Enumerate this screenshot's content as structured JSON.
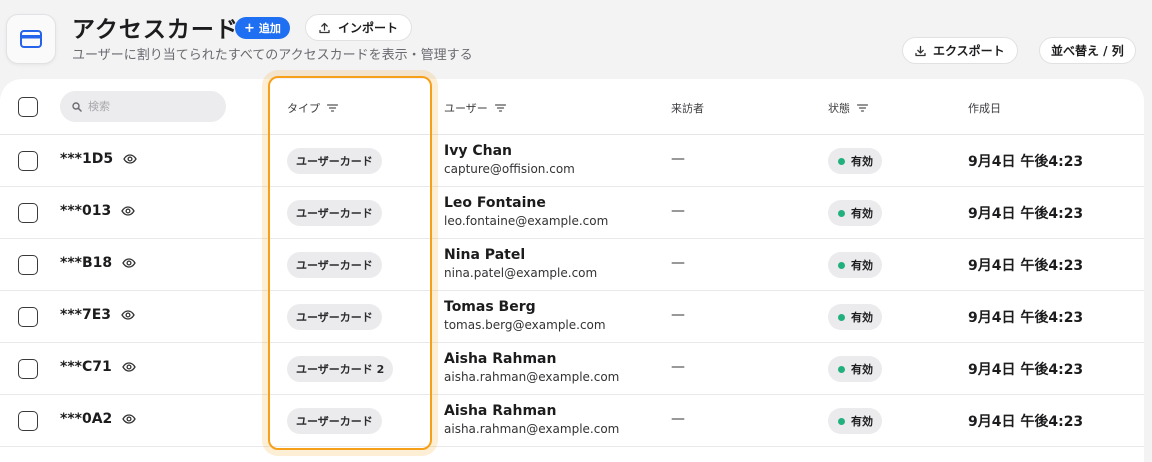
{
  "header": {
    "title": "アクセスカード",
    "add_label": "追加",
    "import_label": "インポート",
    "subtitle": "ユーザーに割り当てられたすべてのアクセスカードを表示・管理する",
    "export_label": "エクスポート",
    "sort_label": "並べ替え / 列"
  },
  "search": {
    "placeholder": "検索"
  },
  "columns": {
    "type": "タイプ",
    "user": "ユーザー",
    "visitor": "来訪者",
    "status": "状態",
    "created": "作成日"
  },
  "rows": [
    {
      "card": "***1D5",
      "type": "ユーザーカード",
      "name": "Ivy Chan",
      "email": "capture@offision.com",
      "visitor": "—",
      "status": "有効",
      "created": "9月4日 午後4:23"
    },
    {
      "card": "***013",
      "type": "ユーザーカード",
      "name": "Leo Fontaine",
      "email": "leo.fontaine@example.com",
      "visitor": "—",
      "status": "有効",
      "created": "9月4日 午後4:23"
    },
    {
      "card": "***B18",
      "type": "ユーザーカード",
      "name": "Nina Patel",
      "email": "nina.patel@example.com",
      "visitor": "—",
      "status": "有効",
      "created": "9月4日 午後4:23"
    },
    {
      "card": "***7E3",
      "type": "ユーザーカード",
      "name": "Tomas Berg",
      "email": "tomas.berg@example.com",
      "visitor": "—",
      "status": "有効",
      "created": "9月4日 午後4:23"
    },
    {
      "card": "***C71",
      "type": "ユーザーカード 2",
      "name": "Aisha Rahman",
      "email": "aisha.rahman@example.com",
      "visitor": "—",
      "status": "有効",
      "created": "9月4日 午後4:23"
    },
    {
      "card": "***0A2",
      "type": "ユーザーカード",
      "name": "Aisha Rahman",
      "email": "aisha.rahman@example.com",
      "visitor": "—",
      "status": "有効",
      "created": "9月4日 午後4:23"
    }
  ],
  "colors": {
    "accent": "#1f6ff2",
    "highlight": "#f6a01a",
    "status_active": "#22b07d"
  },
  "icons": {
    "app": "credit-card-icon",
    "add": "plus-icon",
    "import": "upload-icon",
    "export": "download-icon",
    "search": "search-icon",
    "filter": "filter-icon",
    "reveal": "eye-icon"
  }
}
